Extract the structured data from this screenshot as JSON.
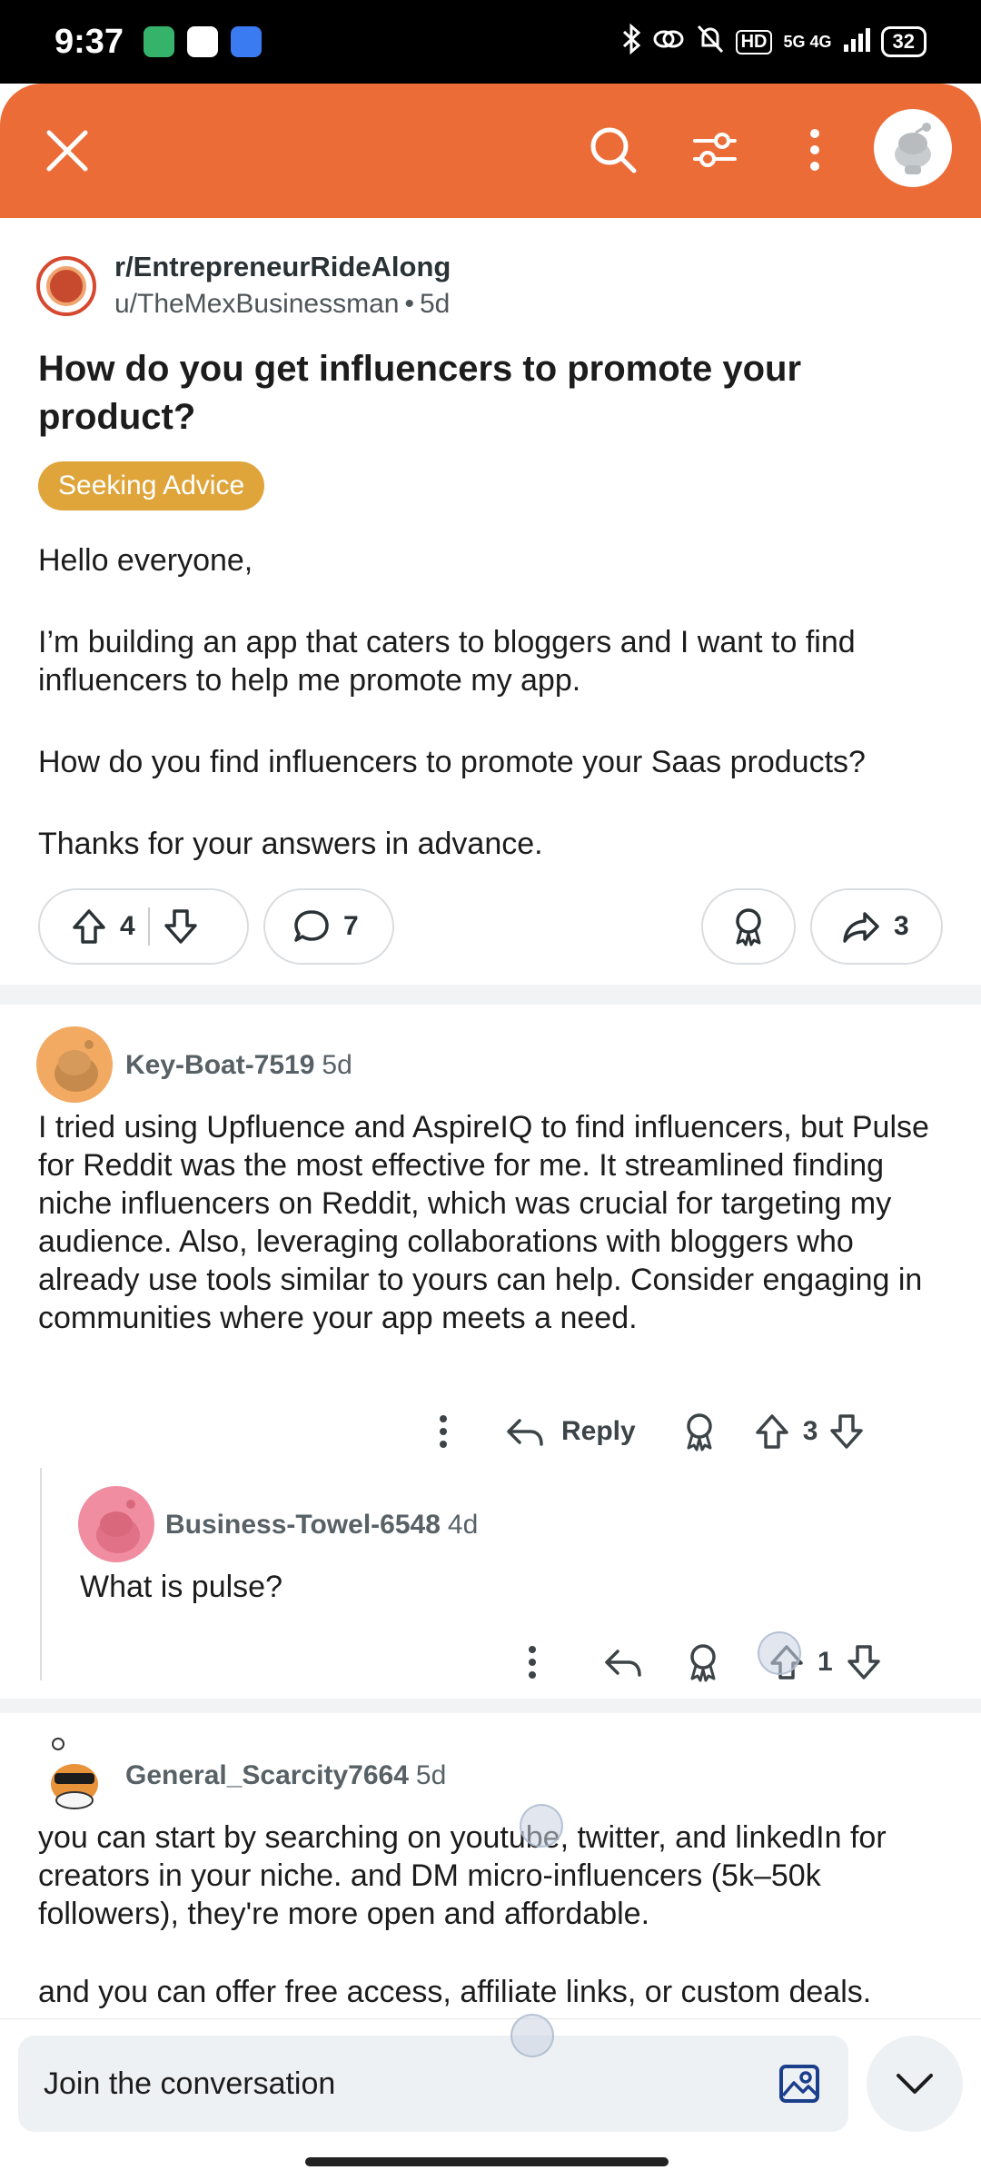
{
  "status_bar": {
    "time": "9:37",
    "network": "5G 4G",
    "hd_label": "HD",
    "battery": "32"
  },
  "header": {
    "icons": [
      "close-icon",
      "search-icon",
      "filter-icon",
      "more-vertical-icon",
      "avatar"
    ]
  },
  "post": {
    "subreddit": "r/EntrepreneurRideAlong",
    "author": "u/TheMexBusinessman",
    "separator": "•",
    "age": "5d",
    "title": "How do you get influencers to promote your product?",
    "flair": "Seeking Advice",
    "body": [
      "Hello everyone,",
      "I’m building an app that caters to bloggers and I want to find influencers to help me promote my app.",
      "How do you find influencers to promote your Saas products?",
      "Thanks for your answers in advance."
    ],
    "votes": "4",
    "comments": "7",
    "shares": "3"
  },
  "comments": [
    {
      "user": "Key-Boat-7519",
      "age": "5d",
      "body": "I tried using Upfluence and AspireIQ to find influencers, but Pulse for Reddit was the most effective for me. It streamlined finding niche influencers on Reddit, which was crucial for targeting my audience. Also, leveraging collaborations with bloggers who already use tools similar to yours can help. Consider engaging in communities where your app meets a need.",
      "reply_label": "Reply",
      "votes": "3"
    },
    {
      "user": "Business-Towel-6548",
      "age": "4d",
      "body": "What is pulse?",
      "votes": "1"
    },
    {
      "user": "General_Scarcity7664",
      "age": "5d",
      "body": [
        "you can start by searching on youtube, twitter, and linkedIn for creators in your niche. and DM micro-influencers (5k–50k followers), they're more open and affordable.",
        "and you can offer free access, affiliate links, or custom deals."
      ]
    }
  ],
  "bottom_bar": {
    "placeholder": "Join the conversation"
  },
  "colors": {
    "header": "#eb6c37",
    "flair": "#dfa53b"
  }
}
